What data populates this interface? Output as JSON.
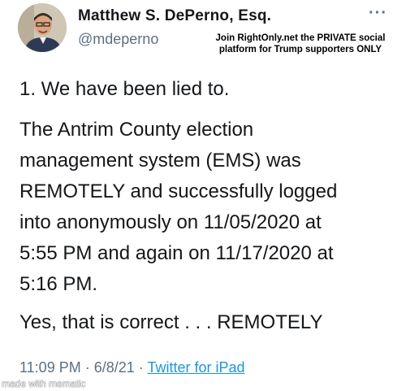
{
  "author": {
    "display_name": "Matthew S. DePerno, Esq.",
    "handle": "@mdeperno",
    "avatar_icon": "user-avatar-photo"
  },
  "more_label": "···",
  "promo": {
    "line1": "Join RightOnly.net the PRIVATE social",
    "line2": "platform for Trump supporters ONLY"
  },
  "tweet": {
    "lines": [
      "1. We have been lied to.",
      "The Antrim County election",
      "management system (EMS) was",
      "REMOTELY and successfully logged",
      "into anonymously on 11/05/2020 at",
      "5:55 PM and again on 11/17/2020 at",
      "5:16 PM.",
      "Yes, that is correct . . . REMOTELY"
    ]
  },
  "meta": {
    "time": "11:09 PM",
    "sep1": " · ",
    "date": "6/8/21",
    "sep2": " · ",
    "source": "Twitter for iPad"
  },
  "watermark": "made with mematic"
}
